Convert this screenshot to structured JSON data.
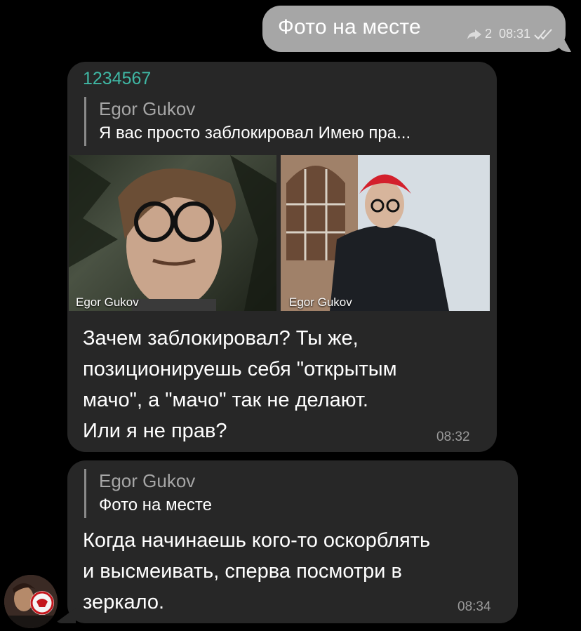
{
  "outgoing": {
    "text": "Фото на месте",
    "forward_count": "2",
    "time": "08:31"
  },
  "message1": {
    "sender": "1234567",
    "reply": {
      "name": "Egor Gukov",
      "text": "Я вас просто заблокировал  Имею пра..."
    },
    "photos": [
      {
        "label": "Egor Gukov"
      },
      {
        "label": "Egor Gukov"
      }
    ],
    "lines": [
      "Зачем заблокировал? Ты же,",
      "позиционируешь себя \"открытым",
      "мачо\", а \"мачо\" так не делают.",
      "Или я не прав?"
    ],
    "time": "08:32"
  },
  "message2": {
    "reply": {
      "name": "Egor Gukov",
      "text": "Фото на месте"
    },
    "lines": [
      "Когда начинаешь кого-то оскорблять",
      "и высмеивать, сперва посмотри в",
      "зеркало."
    ],
    "time": "08:34"
  },
  "icons": {
    "forward": "forward-icon",
    "read_status": "double-check-icon",
    "avatar": "avatar"
  },
  "colors": {
    "background": "#000000",
    "incoming_bubble": "#272727",
    "outgoing_bubble": "#a6a6a6",
    "sender_name": "#3fb7a4"
  }
}
